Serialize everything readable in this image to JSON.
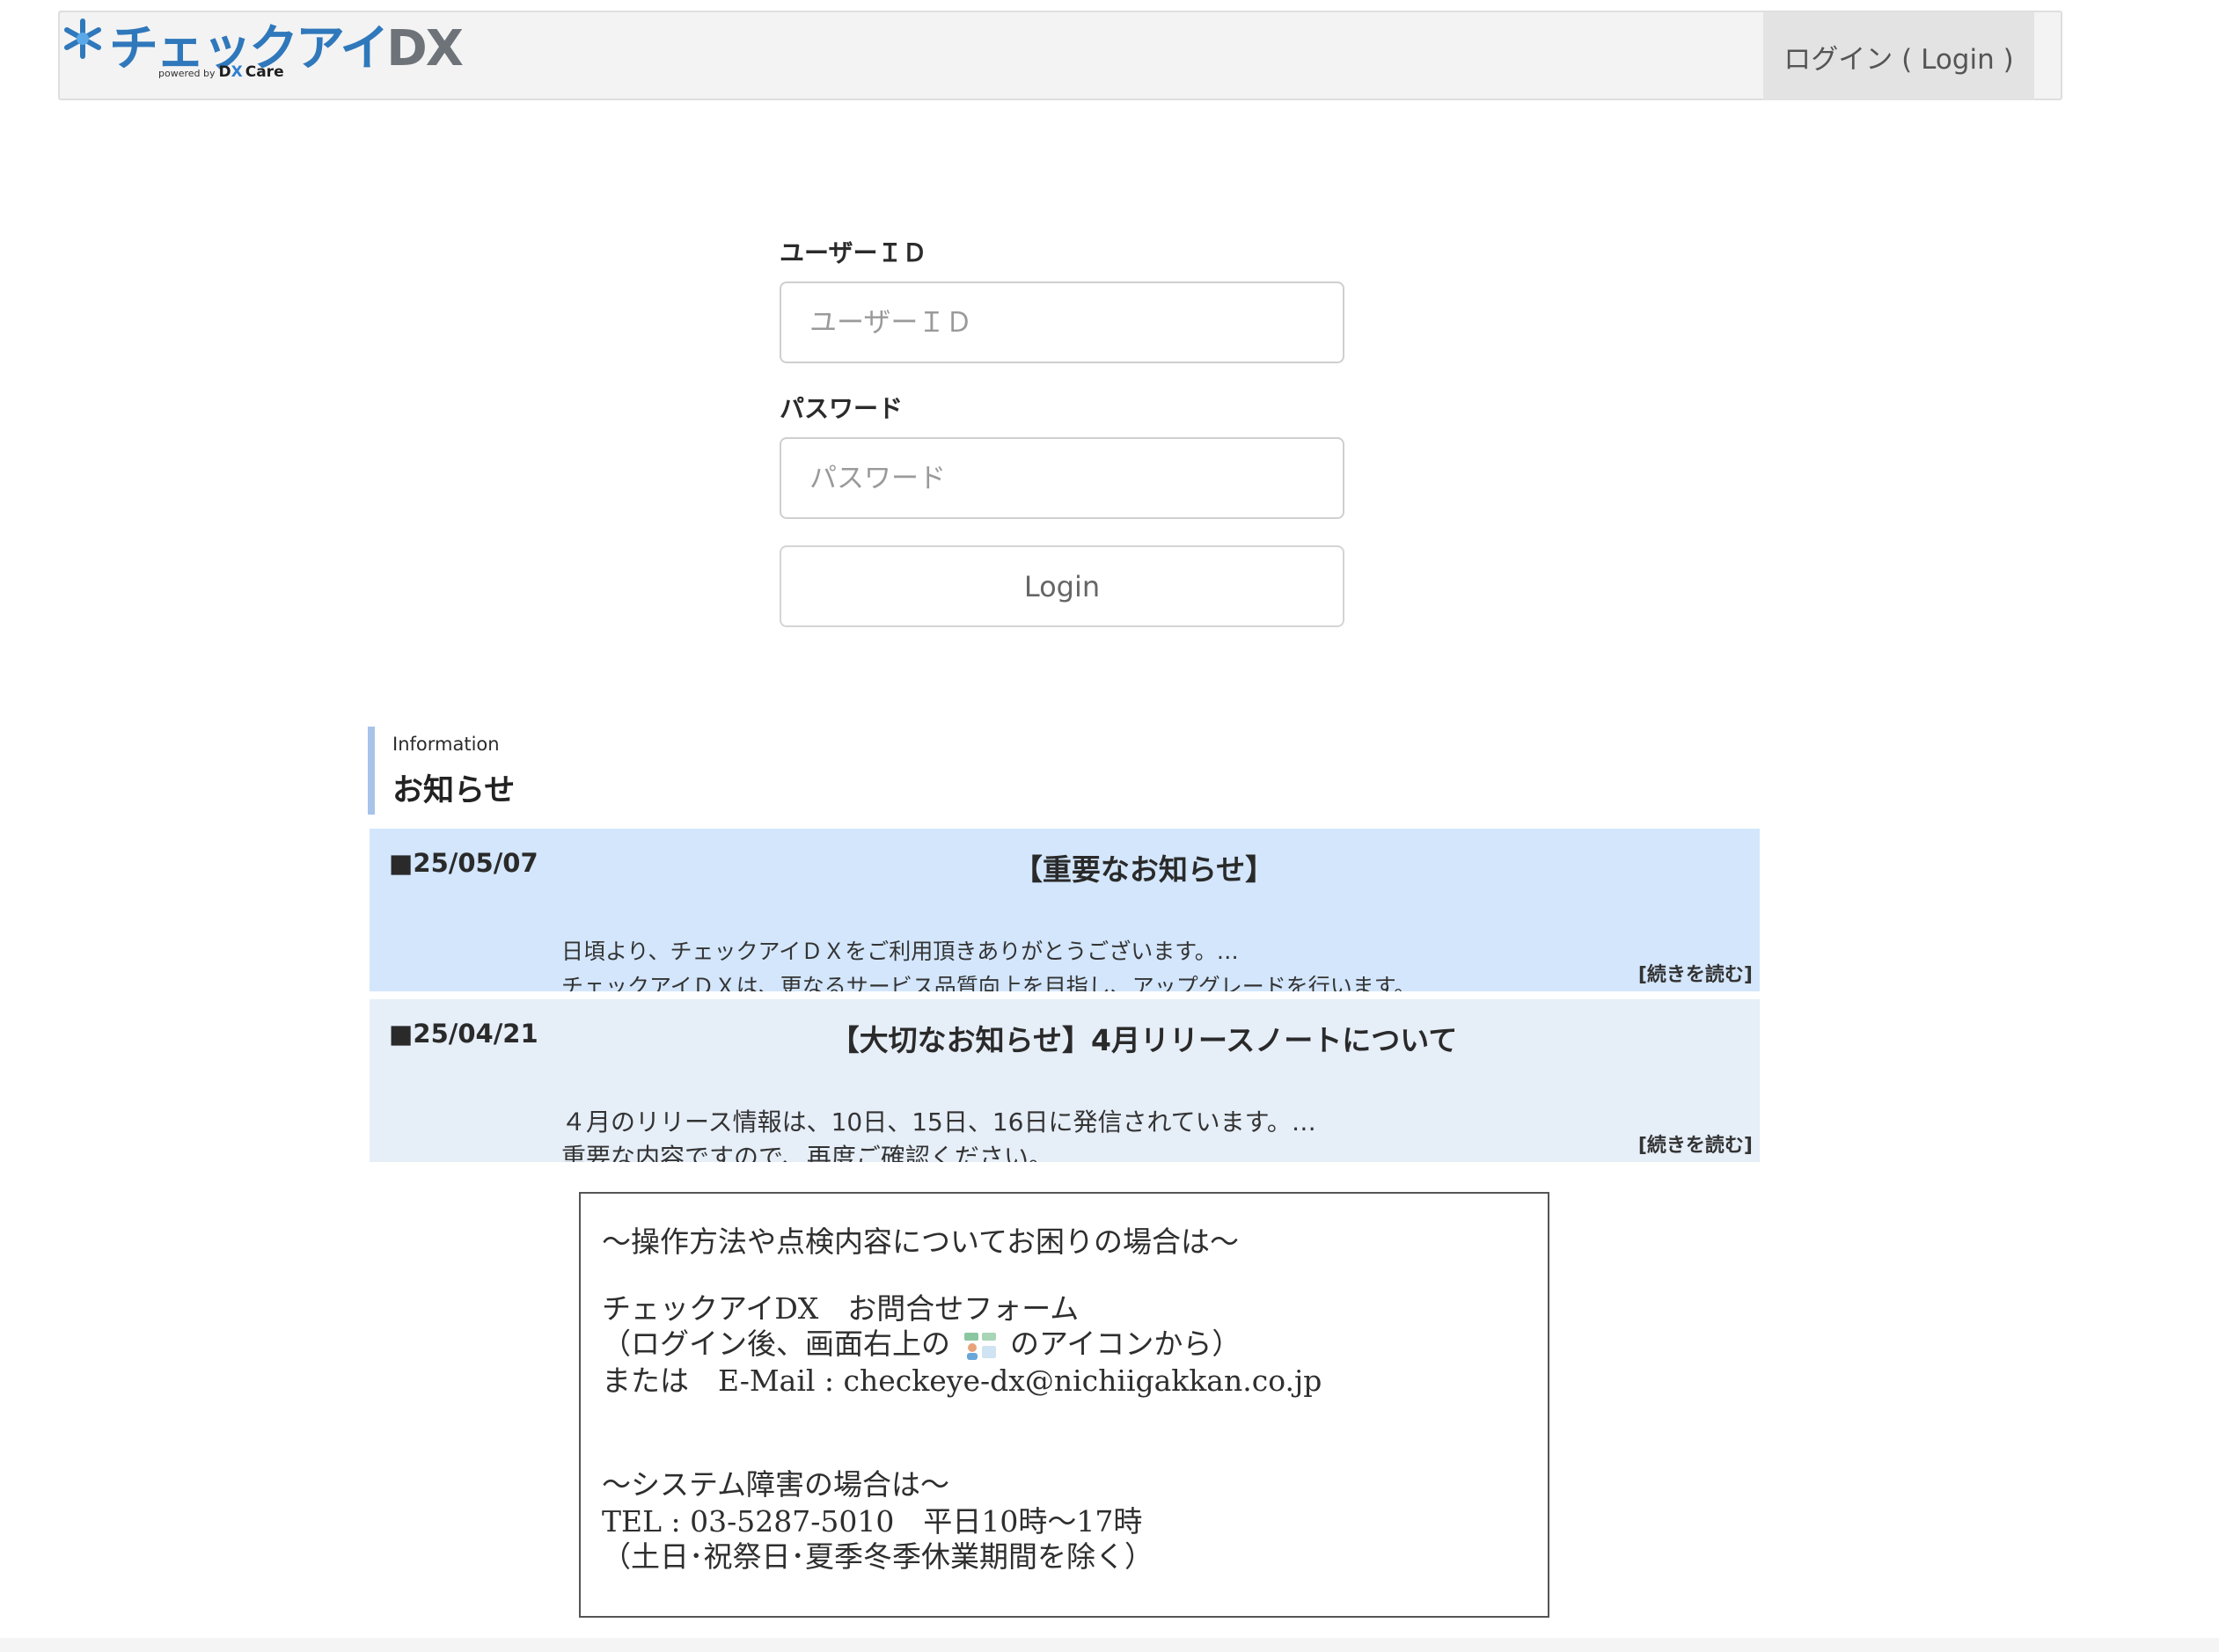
{
  "header": {
    "logo_text": "チェックアイ",
    "logo_dx": "DX",
    "logo_powered": "powered by",
    "logo_brand_d": "D",
    "logo_brand_x": "X",
    "logo_brand_care": "Care",
    "login_label": "ログイン ( Login )"
  },
  "form": {
    "userid_label": "ユーザーＩＤ",
    "userid_placeholder": "ユーザーＩＤ",
    "password_label": "パスワード",
    "password_placeholder": "パスワード",
    "submit_label": "Login"
  },
  "info": {
    "subtitle": "Information",
    "title": "お知らせ",
    "notices": [
      {
        "date": "■25/05/07",
        "title": "【重要なお知らせ】",
        "line1": "日頃より、チェックアイＤＸをご利用頂きありがとうございます。…",
        "line2": "チェックアイＤＸは、更なるサービス品質向上を目指し、アップグレードを行います。",
        "more": "[続きを読む]"
      },
      {
        "date": "■25/04/21",
        "title": "【大切なお知らせ】4月リリースノートについて",
        "line1": "４月のリリース情報は、10日、15日、16日に発信されています。…",
        "line2": "重要な内容ですので、再度ご確認ください。",
        "more": "[続きを読む]"
      }
    ]
  },
  "support": {
    "heading1": "～操作方法や点検内容についてお困りの場合は～",
    "form_line": "チェックアイDX　お問合せフォーム",
    "form_note_pre": "（ログイン後、画面右上の",
    "form_note_post": "のアイコンから）",
    "email_line": "または　E-Mail : checkeye-dx@nichiigakkan.co.jp",
    "heading2": "～システム障害の場合は～",
    "tel_line": "TEL : 03-5287-5010　平日10時～17時",
    "tel_note": "（土日･祝祭日･夏季冬季休業期間を除く）"
  }
}
